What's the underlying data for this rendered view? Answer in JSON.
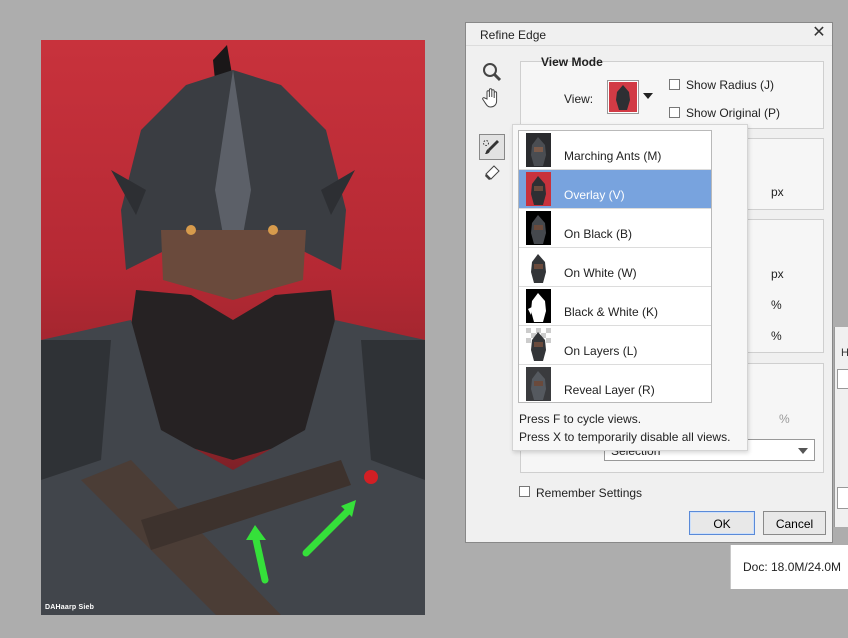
{
  "canvas": {
    "signature_text": "DAHaarp Sieb"
  },
  "dialog": {
    "title": "Refine Edge",
    "close_icon": "close-icon",
    "tools": [
      "zoom-tool-icon",
      "hand-tool-icon",
      "refine-radius-brush-icon",
      "erase-refinements-icon"
    ],
    "view_mode": {
      "section_title": "View Mode",
      "view_label": "View:",
      "show_radius": "Show Radius (J)",
      "show_original": "Show Original (P)"
    },
    "units": {
      "px1": "px",
      "px2": "px",
      "pct1": "%",
      "pct2": "%",
      "pct3": "%"
    },
    "output_select": "Selection",
    "remember_settings": "Remember Settings",
    "ok_label": "OK",
    "cancel_label": "Cancel"
  },
  "view_popup": {
    "items": [
      {
        "label": "Marching Ants (M)",
        "thumb": "marching-ants"
      },
      {
        "label": "Overlay (V)",
        "thumb": "overlay"
      },
      {
        "label": "On Black (B)",
        "thumb": "on-black"
      },
      {
        "label": "On White (W)",
        "thumb": "on-white"
      },
      {
        "label": "Black & White (K)",
        "thumb": "black-white"
      },
      {
        "label": "On Layers (L)",
        "thumb": "on-layers"
      },
      {
        "label": "Reveal Layer (R)",
        "thumb": "reveal-layer"
      }
    ],
    "selected_index": 1,
    "hint1": "Press F to cycle views.",
    "hint2": "Press X to temporarily disable all views."
  },
  "background_panel": {
    "label": "H"
  },
  "status_bar": {
    "doc": "Doc: 18.0M/24.0M"
  },
  "colors": {
    "selected_row": "#78a3de",
    "annotation_arrow": "#35e03a",
    "canvas_red": "#c8323c"
  }
}
